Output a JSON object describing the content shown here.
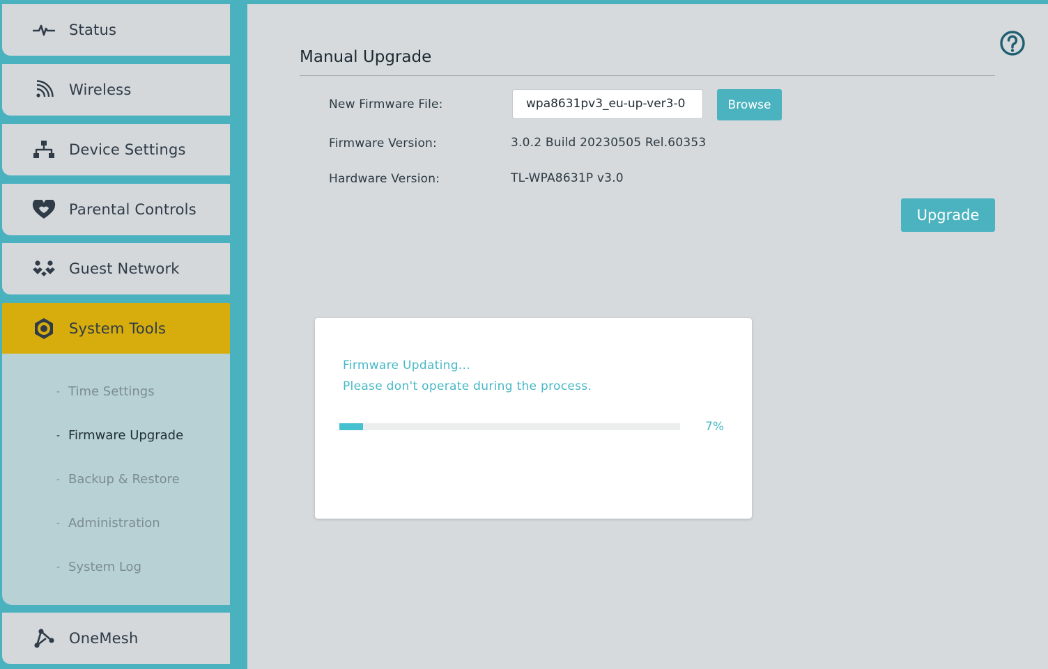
{
  "sidebar": {
    "items": [
      {
        "label": "Status",
        "icon": "pulse-icon"
      },
      {
        "label": "Wireless",
        "icon": "wifi-icon"
      },
      {
        "label": "Device Settings",
        "icon": "network-icon"
      },
      {
        "label": "Parental Controls",
        "icon": "heart-icon"
      },
      {
        "label": "Guest Network",
        "icon": "guests-icon"
      },
      {
        "label": "System Tools",
        "icon": "gear-icon"
      },
      {
        "label": "OneMesh",
        "icon": "mesh-icon"
      }
    ],
    "active": "System Tools",
    "submenu": [
      {
        "label": "Time Settings"
      },
      {
        "label": "Firmware Upgrade"
      },
      {
        "label": "Backup & Restore"
      },
      {
        "label": "Administration"
      },
      {
        "label": "System Log"
      }
    ],
    "submenu_active": "Firmware Upgrade"
  },
  "main": {
    "section_title": "Manual Upgrade",
    "new_firmware_label": "New Firmware File:",
    "new_firmware_value": "wpa8631pv3_eu-up-ver3-0",
    "browse_label": "Browse",
    "firmware_version_label": "Firmware Version:",
    "firmware_version_value": "3.0.2 Build 20230505 Rel.60353",
    "hardware_version_label": "Hardware Version:",
    "hardware_version_value": "TL-WPA8631P v3.0",
    "upgrade_label": "Upgrade"
  },
  "modal": {
    "line1": "Firmware Updating...",
    "line2": "Please don't operate during the process.",
    "progress_percent": 7,
    "progress_text": "7%"
  },
  "colors": {
    "accent": "#4ab1bf",
    "active_nav": "#d7ad0d",
    "submenu_bg": "#b7d1d4",
    "modal_text": "#47b8c6"
  }
}
